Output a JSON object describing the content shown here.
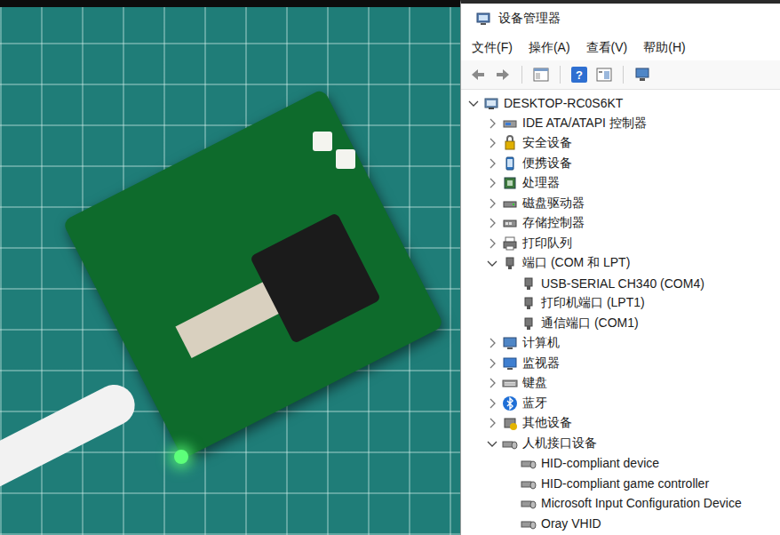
{
  "window": {
    "title": "设备管理器"
  },
  "menu": [
    "文件(F)",
    "操作(A)",
    "查看(V)",
    "帮助(H)"
  ],
  "toolbar": {
    "help": "?"
  },
  "tree": {
    "label": "DESKTOP-RC0S6KT",
    "expanded": true,
    "children": [
      {
        "label": "IDE ATA/ATAPI 控制器",
        "expanded": false
      },
      {
        "label": "安全设备",
        "expanded": false
      },
      {
        "label": "便携设备",
        "expanded": false
      },
      {
        "label": "处理器",
        "expanded": false
      },
      {
        "label": "磁盘驱动器",
        "expanded": false
      },
      {
        "label": "存储控制器",
        "expanded": false
      },
      {
        "label": "打印队列",
        "expanded": false
      },
      {
        "label": "端口 (COM 和 LPT)",
        "expanded": true,
        "children": [
          {
            "label": "USB-SERIAL CH340 (COM4)"
          },
          {
            "label": "打印机端口 (LPT1)"
          },
          {
            "label": "通信端口 (COM1)"
          }
        ]
      },
      {
        "label": "计算机",
        "expanded": false
      },
      {
        "label": "监视器",
        "expanded": false
      },
      {
        "label": "键盘",
        "expanded": false
      },
      {
        "label": "蓝牙",
        "expanded": false
      },
      {
        "label": "其他设备",
        "expanded": false
      },
      {
        "label": "人机接口设备",
        "expanded": true,
        "children": [
          {
            "label": "HID-compliant device"
          },
          {
            "label": "HID-compliant game controller"
          },
          {
            "label": "Microsoft Input Configuration Device"
          },
          {
            "label": "Oray VHID"
          }
        ]
      }
    ]
  }
}
